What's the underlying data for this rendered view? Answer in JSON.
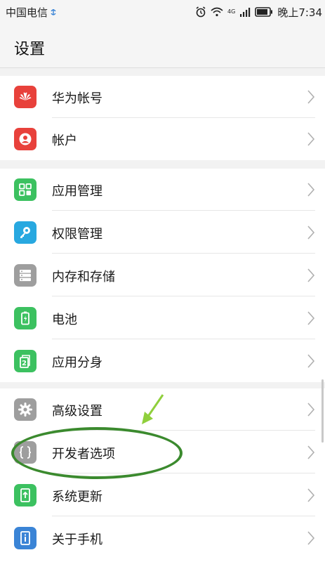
{
  "status_bar": {
    "carrier": "中国电信",
    "time": "晚上7:34",
    "network": "4G"
  },
  "header": {
    "title": "设置"
  },
  "groups": [
    {
      "items": [
        {
          "label": "华为帐号",
          "icon": "huawei-logo-icon",
          "color": "#e8413b"
        },
        {
          "label": "帐户",
          "icon": "user-icon",
          "color": "#e8413b"
        }
      ]
    },
    {
      "items": [
        {
          "label": "应用管理",
          "icon": "app-grid-icon",
          "color": "#3cc160"
        },
        {
          "label": "权限管理",
          "icon": "key-icon",
          "color": "#28a8e0"
        },
        {
          "label": "内存和存储",
          "icon": "storage-icon",
          "color": "#9e9e9e"
        },
        {
          "label": "电池",
          "icon": "battery-icon",
          "color": "#3cc160"
        },
        {
          "label": "应用分身",
          "icon": "app-twin-icon",
          "color": "#3cc160"
        }
      ]
    },
    {
      "items": [
        {
          "label": "高级设置",
          "icon": "gear-icon",
          "color": "#9e9e9e"
        },
        {
          "label": "开发者选项",
          "icon": "braces-icon",
          "color": "#9e9e9e"
        },
        {
          "label": "系统更新",
          "icon": "system-update-icon",
          "color": "#3cc160"
        },
        {
          "label": "关于手机",
          "icon": "phone-info-icon",
          "color": "#3a84d6"
        }
      ]
    }
  ],
  "annotation_color": "#3b8a2e"
}
